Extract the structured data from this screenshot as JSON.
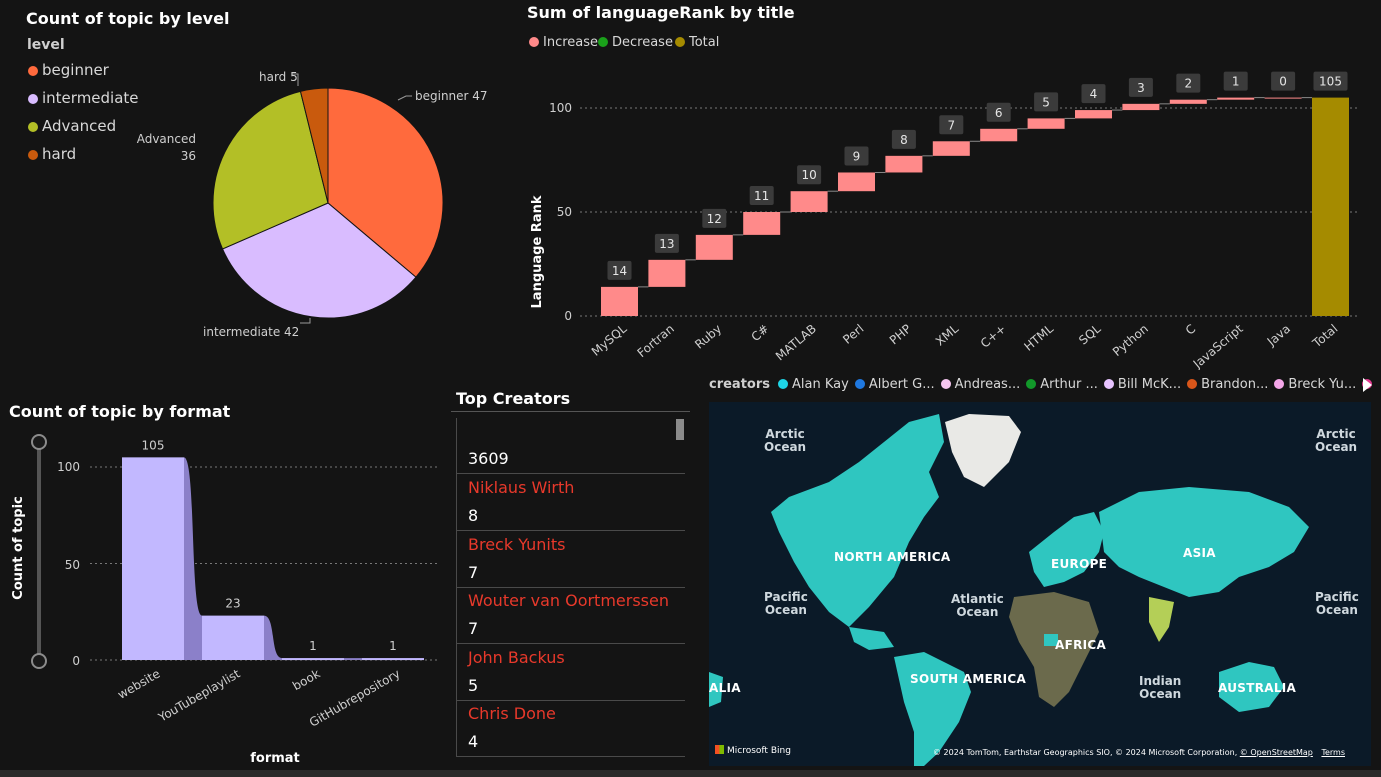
{
  "pie": {
    "title": "Count of topic by level",
    "legend_title": "level",
    "slices": [
      {
        "label": "beginner",
        "value": 47,
        "color": "#ff6a3d"
      },
      {
        "label": "intermediate",
        "value": 42,
        "color": "#d9bcff"
      },
      {
        "label": "Advanced",
        "value": 36,
        "color": "#b3bf26"
      },
      {
        "label": "hard",
        "value": 5,
        "color": "#c95a0d"
      }
    ],
    "data_labels": {
      "beginner": "beginner 47",
      "intermediate": "intermediate 42",
      "advanced_line1": "Advanced",
      "advanced_line2": "36",
      "hard": "hard 5"
    }
  },
  "waterfall": {
    "title": "Sum of languageRank by title",
    "legend": [
      {
        "label": "Increase",
        "color": "#ff8a8a"
      },
      {
        "label": "Decrease",
        "color": "#1aa11a"
      },
      {
        "label": "Total",
        "color": "#a58b00"
      }
    ],
    "ylabel": "Language Rank",
    "yticks": [
      "0",
      "50",
      "100"
    ]
  },
  "format_chart": {
    "title": "Count of topic by format",
    "ylabel": "Count of topic",
    "xlabel": "format",
    "yticks": [
      "0",
      "50",
      "100"
    ]
  },
  "top_creators": {
    "title": "Top Creators",
    "header_count": "3609",
    "rows": [
      {
        "name": "Niklaus Wirth",
        "count": "8"
      },
      {
        "name": "Breck Yunits",
        "count": "7"
      },
      {
        "name": "Wouter van Oortmerssen",
        "count": "7"
      },
      {
        "name": "John Backus",
        "count": "5"
      },
      {
        "name": "Chris Done",
        "count": "4"
      }
    ]
  },
  "map": {
    "legend_title": "creators",
    "legend": [
      {
        "label": "Alan Kay",
        "color": "#1ed5e6"
      },
      {
        "label": "Albert G...",
        "color": "#1f78e0"
      },
      {
        "label": "Andreas...",
        "color": "#f6c6f0"
      },
      {
        "label": "Arthur ...",
        "color": "#12992a"
      },
      {
        "label": "Bill McK...",
        "color": "#e7c3ff"
      },
      {
        "label": "Brandon...",
        "color": "#d9561a"
      },
      {
        "label": "Breck Yu...",
        "color": "#f4a6e8"
      },
      {
        "label": "",
        "color": "#e2388f"
      }
    ],
    "labels": {
      "arctic_left": "Arctic\nOcean",
      "arctic_right": "Arctic\nOcean",
      "pacific_left": "Pacific\nOcean",
      "pacific_right": "Pacific\nOcean",
      "atlantic": "Atlantic\nOcean",
      "indian": "Indian\nOcean",
      "north_america": "NORTH AMERICA",
      "south_america": "SOUTH AMERICA",
      "europe": "EUROPE",
      "asia": "ASIA",
      "africa": "AFRICA",
      "australia": "AUSTRALIA",
      "alia": "ALIA"
    },
    "bing": "Microsoft Bing",
    "attribution": "© 2024 TomTom, Earthstar Geographics SIO, © 2024 Microsoft Corporation,",
    "osm": "© OpenStreetMap",
    "terms": "Terms"
  },
  "chart_data": [
    {
      "type": "pie",
      "title": "Count of topic by level",
      "categories": [
        "beginner",
        "intermediate",
        "Advanced",
        "hard"
      ],
      "values": [
        47,
        42,
        36,
        5
      ],
      "legend": "top-left"
    },
    {
      "type": "bar",
      "title": "Sum of languageRank by title",
      "categories": [
        "MySQL",
        "Fortran",
        "Ruby",
        "C#",
        "MATLAB",
        "Perl",
        "PHP",
        "XML",
        "C++",
        "HTML",
        "SQL",
        "Python",
        "C",
        "JavaScript",
        "Java",
        "Total"
      ],
      "values": [
        14,
        13,
        12,
        11,
        10,
        9,
        8,
        7,
        6,
        5,
        4,
        3,
        2,
        1,
        0,
        105
      ],
      "ylabel": "Language Rank",
      "ylim": [
        0,
        105
      ],
      "grid": true,
      "legend": "top-left"
    },
    {
      "type": "area",
      "title": "Count of topic by format",
      "categories": [
        "website",
        "YouTubeplaylist",
        "book",
        "GitHubrepository"
      ],
      "values": [
        105,
        23,
        1,
        1
      ],
      "xlabel": "format",
      "ylabel": "Count of topic",
      "ylim": [
        0,
        105
      ],
      "grid": true
    }
  ]
}
